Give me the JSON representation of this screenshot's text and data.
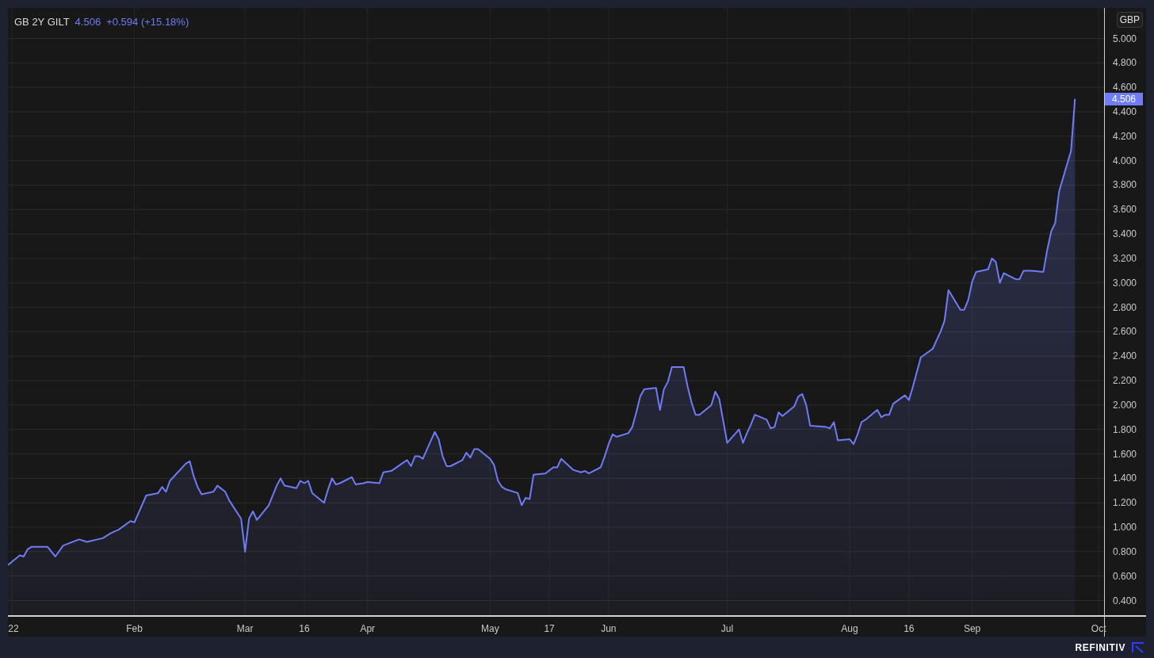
{
  "legend": {
    "last": "4.506",
    "change": "+0.594 (+15.18%)"
  },
  "currency": "GBP",
  "price_tag": "4.506",
  "chart_data": {
    "type": "area",
    "x": [
      "2021-12-31",
      "2022-01-03",
      "2022-01-04",
      "2022-01-05",
      "2022-01-06",
      "2022-01-10",
      "2022-01-12",
      "2022-01-14",
      "2022-01-18",
      "2022-01-20",
      "2022-01-24",
      "2022-01-26",
      "2022-01-28",
      "2022-01-31",
      "2022-02-01",
      "2022-02-04",
      "2022-02-07",
      "2022-02-08",
      "2022-02-09",
      "2022-02-10",
      "2022-02-14",
      "2022-02-15",
      "2022-02-16",
      "2022-02-17",
      "2022-02-18",
      "2022-02-21",
      "2022-02-22",
      "2022-02-24",
      "2022-02-25",
      "2022-02-28",
      "2022-03-01",
      "2022-03-02",
      "2022-03-03",
      "2022-03-04",
      "2022-03-07",
      "2022-03-09",
      "2022-03-10",
      "2022-03-11",
      "2022-03-14",
      "2022-03-15",
      "2022-03-16",
      "2022-03-17",
      "2022-03-18",
      "2022-03-21",
      "2022-03-22",
      "2022-03-23",
      "2022-03-24",
      "2022-03-25",
      "2022-03-28",
      "2022-03-29",
      "2022-03-31",
      "2022-04-01",
      "2022-04-04",
      "2022-04-05",
      "2022-04-07",
      "2022-04-11",
      "2022-04-12",
      "2022-04-13",
      "2022-04-14",
      "2022-04-15",
      "2022-04-18",
      "2022-04-19",
      "2022-04-20",
      "2022-04-21",
      "2022-04-22",
      "2022-04-25",
      "2022-04-26",
      "2022-04-27",
      "2022-04-28",
      "2022-04-29",
      "2022-05-02",
      "2022-05-03",
      "2022-05-04",
      "2022-05-05",
      "2022-05-06",
      "2022-05-09",
      "2022-05-10",
      "2022-05-11",
      "2022-05-12",
      "2022-05-13",
      "2022-05-16",
      "2022-05-18",
      "2022-05-19",
      "2022-05-20",
      "2022-05-23",
      "2022-05-25",
      "2022-05-26",
      "2022-05-27",
      "2022-05-30",
      "2022-05-31",
      "2022-06-01",
      "2022-06-02",
      "2022-06-03",
      "2022-06-06",
      "2022-06-07",
      "2022-06-08",
      "2022-06-09",
      "2022-06-10",
      "2022-06-13",
      "2022-06-14",
      "2022-06-15",
      "2022-06-16",
      "2022-06-17",
      "2022-06-20",
      "2022-06-21",
      "2022-06-22",
      "2022-06-23",
      "2022-06-24",
      "2022-06-27",
      "2022-06-28",
      "2022-06-29",
      "2022-06-30",
      "2022-07-01",
      "2022-07-04",
      "2022-07-05",
      "2022-07-06",
      "2022-07-07",
      "2022-07-08",
      "2022-07-11",
      "2022-07-12",
      "2022-07-13",
      "2022-07-14",
      "2022-07-15",
      "2022-07-18",
      "2022-07-19",
      "2022-07-20",
      "2022-07-21",
      "2022-07-22",
      "2022-07-26",
      "2022-07-27",
      "2022-07-28",
      "2022-07-29",
      "2022-08-01",
      "2022-08-02",
      "2022-08-03",
      "2022-08-04",
      "2022-08-05",
      "2022-08-08",
      "2022-08-09",
      "2022-08-10",
      "2022-08-11",
      "2022-08-12",
      "2022-08-15",
      "2022-08-16",
      "2022-08-17",
      "2022-08-19",
      "2022-08-22",
      "2022-08-23",
      "2022-08-24",
      "2022-08-25",
      "2022-08-26",
      "2022-08-29",
      "2022-08-30",
      "2022-08-31",
      "2022-09-01",
      "2022-09-02",
      "2022-09-05",
      "2022-09-06",
      "2022-09-07",
      "2022-09-08",
      "2022-09-09",
      "2022-09-12",
      "2022-09-13",
      "2022-09-14",
      "2022-09-15",
      "2022-09-16",
      "2022-09-19",
      "2022-09-20",
      "2022-09-21",
      "2022-09-22",
      "2022-09-23",
      "2022-09-26",
      "2022-09-27"
    ],
    "series": [
      {
        "name": "GB 2Y GILT",
        "color": "#6f7cf6",
        "values": [
          0.69,
          0.77,
          0.76,
          0.82,
          0.84,
          0.84,
          0.76,
          0.85,
          0.9,
          0.88,
          0.91,
          0.95,
          0.98,
          1.05,
          1.04,
          1.26,
          1.28,
          1.33,
          1.29,
          1.38,
          1.52,
          1.54,
          1.42,
          1.33,
          1.27,
          1.29,
          1.34,
          1.29,
          1.22,
          1.07,
          0.8,
          1.07,
          1.13,
          1.06,
          1.18,
          1.34,
          1.4,
          1.34,
          1.32,
          1.38,
          1.36,
          1.38,
          1.28,
          1.2,
          1.31,
          1.4,
          1.35,
          1.36,
          1.41,
          1.35,
          1.36,
          1.37,
          1.36,
          1.45,
          1.46,
          1.55,
          1.5,
          1.58,
          1.58,
          1.56,
          1.78,
          1.72,
          1.58,
          1.5,
          1.5,
          1.55,
          1.61,
          1.57,
          1.64,
          1.64,
          1.56,
          1.51,
          1.38,
          1.33,
          1.31,
          1.28,
          1.18,
          1.24,
          1.23,
          1.43,
          1.44,
          1.49,
          1.49,
          1.56,
          1.47,
          1.45,
          1.46,
          1.44,
          1.49,
          1.58,
          1.68,
          1.76,
          1.74,
          1.77,
          1.82,
          1.94,
          2.07,
          2.13,
          2.14,
          1.96,
          2.13,
          2.19,
          2.31,
          2.31,
          2.15,
          2.02,
          1.92,
          1.92,
          2.0,
          2.11,
          2.05,
          1.87,
          1.69,
          1.8,
          1.69,
          1.77,
          1.84,
          1.92,
          1.88,
          1.81,
          1.82,
          1.94,
          1.91,
          1.99,
          2.07,
          2.09,
          2.0,
          1.83,
          1.82,
          1.81,
          1.86,
          1.71,
          1.72,
          1.68,
          1.76,
          1.86,
          1.88,
          1.96,
          1.9,
          1.92,
          1.92,
          2.01,
          2.08,
          2.04,
          2.15,
          2.39,
          2.46,
          2.53,
          2.6,
          2.69,
          2.94,
          2.78,
          2.78,
          2.86,
          3.01,
          3.09,
          3.11,
          3.2,
          3.17,
          3.0,
          3.08,
          3.03,
          3.03,
          3.1,
          3.1,
          3.1,
          3.09,
          3.27,
          3.42,
          3.49,
          3.75,
          4.08,
          4.506
        ]
      }
    ],
    "xlim": [
      "2021-12-31",
      "2022-10-15"
    ],
    "grid": true,
    "ylim": [
      0.28,
      5.25
    ],
    "xticks": [
      {
        "value": "2022-01-01",
        "label": "22"
      },
      {
        "value": "2022-02-01",
        "label": "Feb"
      },
      {
        "value": "2022-03-01",
        "label": "Mar"
      },
      {
        "value": "2022-03-16",
        "label": "16"
      },
      {
        "value": "2022-04-01",
        "label": "Apr"
      },
      {
        "value": "2022-05-02",
        "label": "May"
      },
      {
        "value": "2022-05-17",
        "label": "17"
      },
      {
        "value": "2022-06-01",
        "label": "Jun"
      },
      {
        "value": "2022-07-01",
        "label": "Jul"
      },
      {
        "value": "2022-08-01",
        "label": "Aug"
      },
      {
        "value": "2022-08-16",
        "label": "16"
      },
      {
        "value": "2022-09-01",
        "label": "Sep"
      },
      {
        "value": "2022-10-03",
        "label": "Oct"
      }
    ],
    "yticks": [
      {
        "value": 5,
        "label": "5.000"
      },
      {
        "value": 4.8,
        "label": "4.800"
      },
      {
        "value": 4.6,
        "label": "4.600"
      },
      {
        "value": 4.4,
        "label": "4.400"
      },
      {
        "value": 4.2,
        "label": "4.200"
      },
      {
        "value": 4,
        "label": "4.000"
      },
      {
        "value": 3.8,
        "label": "3.800"
      },
      {
        "value": 3.6,
        "label": "3.600"
      },
      {
        "value": 3.4,
        "label": "3.400"
      },
      {
        "value": 3.2,
        "label": "3.200"
      },
      {
        "value": 3,
        "label": "3.000"
      },
      {
        "value": 2.8,
        "label": "2.800"
      },
      {
        "value": 2.6,
        "label": "2.600"
      },
      {
        "value": 2.4,
        "label": "2.400"
      },
      {
        "value": 2.2,
        "label": "2.200"
      },
      {
        "value": 2,
        "label": "2.000"
      },
      {
        "value": 1.8,
        "label": "1.800"
      },
      {
        "value": 1.6,
        "label": "1.600"
      },
      {
        "value": 1.4,
        "label": "1.400"
      },
      {
        "value": 1.2,
        "label": "1.200"
      },
      {
        "value": 1,
        "label": "1.000"
      },
      {
        "value": 0.8,
        "label": "0.800"
      },
      {
        "value": 0.6,
        "label": "0.600"
      },
      {
        "value": 0.4,
        "label": "0.400"
      }
    ]
  },
  "footer": {
    "brand": "REFINITIV"
  }
}
